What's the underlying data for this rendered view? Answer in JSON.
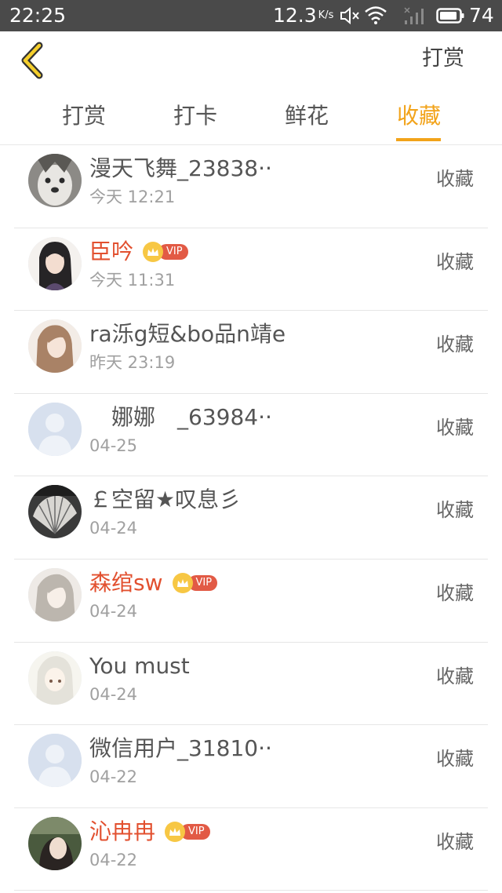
{
  "status_bar": {
    "time": "22:25",
    "net_speed": "12.3",
    "net_unit": "K/s",
    "battery": "74",
    "icons": [
      "mute-icon",
      "wifi-icon",
      "signal-icon",
      "battery-icon"
    ]
  },
  "header": {
    "back_icon": "chevron-left-icon",
    "action_label": "打赏"
  },
  "tabs": [
    {
      "label": "打赏",
      "active": false
    },
    {
      "label": "打卡",
      "active": false
    },
    {
      "label": "鲜花",
      "active": false
    },
    {
      "label": "收藏",
      "active": true
    }
  ],
  "colors": {
    "accent": "#f2a31a",
    "vip_name": "#e2502f",
    "status_bar": "#4a4a4a"
  },
  "vip_label": "VIP",
  "rows": [
    {
      "name": "漫天飞舞_23838··",
      "time": "今天 12:21",
      "action": "收藏",
      "vip": false,
      "avatar": "dog"
    },
    {
      "name": "臣吟",
      "time": "今天 11:31",
      "action": "收藏",
      "vip": true,
      "avatar": "anime-man"
    },
    {
      "name": "ra泺g短&bo品n靖e",
      "time": "昨天 23:19",
      "action": "收藏",
      "vip": false,
      "avatar": "girl"
    },
    {
      "name": "　娜娜　_63984··",
      "time": "04-25",
      "action": "收藏",
      "vip": false,
      "avatar": "default"
    },
    {
      "name": "￡空留★叹息彡",
      "time": "04-24",
      "action": "收藏",
      "vip": false,
      "avatar": "fan"
    },
    {
      "name": "森绾sw",
      "time": "04-24",
      "action": "收藏",
      "vip": true,
      "avatar": "anime-girl"
    },
    {
      "name": "You must",
      "time": "04-24",
      "action": "收藏",
      "vip": false,
      "avatar": "white-hair"
    },
    {
      "name": "微信用户_31810··",
      "time": "04-22",
      "action": "收藏",
      "vip": false,
      "avatar": "default"
    },
    {
      "name": "沁冉冉",
      "time": "04-22",
      "action": "收藏",
      "vip": true,
      "avatar": "photo"
    }
  ]
}
